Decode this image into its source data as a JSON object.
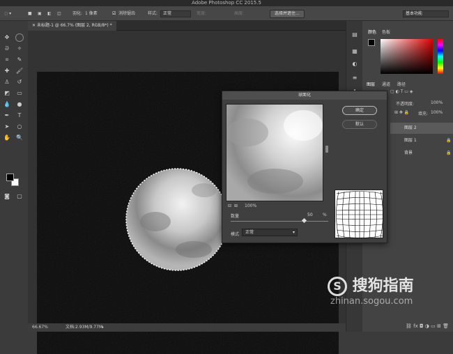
{
  "app": {
    "window_title": "Adobe Photoshop CC 2015.5"
  },
  "options_bar": {
    "feather_label": "羽化:",
    "feather_value": "1 像素",
    "antialias_label": "消除锯齿",
    "style_label": "样式:",
    "style_value": "正常",
    "width_label": "宽度:",
    "height_label": "高度:",
    "select_mask_button": "选择并遮住...",
    "workspace_value": "基本功能"
  },
  "document": {
    "tab_title": "未标题-1 @ 66.7% (图层 2, RGB/8*) *"
  },
  "status": {
    "zoom": "66.67%",
    "doc_size": "文档:2.93M/9.77M"
  },
  "panels": {
    "color_tab": "颜色",
    "swatches_tab": "色板",
    "layers_tab": "图层",
    "channels_tab": "通道",
    "paths_tab": "路径",
    "opacity_label": "不透明度:",
    "opacity_value": "100%",
    "fill_label": "填充:",
    "fill_value": "100%",
    "layers": [
      {
        "name": "图层 2"
      },
      {
        "name": "图层 1"
      },
      {
        "name": "背景"
      }
    ]
  },
  "dialog": {
    "title": "球面化",
    "ok_button": "确定",
    "cancel_button": "默认",
    "zoom_value": "100%",
    "amount_label": "数量",
    "amount_value": "50",
    "amount_unit": "%",
    "amount_fraction": 0.75,
    "mode_label": "模式",
    "mode_value": "正常"
  },
  "watermark": {
    "brand": "搜狗指南",
    "url": "zhinan.sogou.com"
  },
  "colors": {
    "accent": "#4a90d9",
    "foreground": "#000000",
    "background": "#ffffff"
  }
}
